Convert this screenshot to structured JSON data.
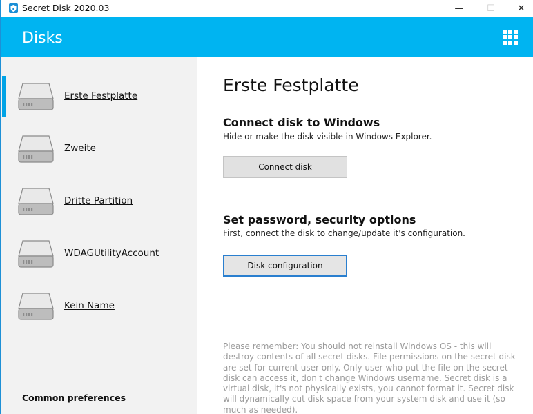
{
  "window": {
    "title": "Secret Disk 2020.03",
    "controls": {
      "minimize": "—",
      "maximize": "☐",
      "close": "✕"
    }
  },
  "header": {
    "title": "Disks",
    "apps_icon": "grid-apps-icon",
    "accent_color": "#00b4f1"
  },
  "sidebar": {
    "disks": [
      {
        "label": "Erste Festplatte",
        "active": true
      },
      {
        "label": "Zweite",
        "active": false
      },
      {
        "label": "Dritte Partition",
        "active": false
      },
      {
        "label": "WDAGUtilityAccount",
        "active": false
      },
      {
        "label": "Kein Name",
        "active": false
      }
    ],
    "common_preferences": "Common preferences"
  },
  "main": {
    "disk_title": "Erste Festplatte",
    "connect_section": {
      "title": "Connect disk to Windows",
      "description": "Hide or make the disk visible in Windows Explorer.",
      "button": "Connect disk"
    },
    "config_section": {
      "title": "Set password, security options",
      "description": "First, connect the disk to change/update it's configuration.",
      "button": "Disk configuration"
    },
    "notice": "Please remember: You should not reinstall Windows OS - this will destroy contents of all secret disks. File permissions on the secret disk are set for current user only. Only user who put the file on the secret disk can access it, don't change Windows username. Secret disk is a virtual disk, it's not physically exists, you cannot format it. Secret disk will dynamically cut disk space from your system disk and use it (so much as needed)."
  }
}
